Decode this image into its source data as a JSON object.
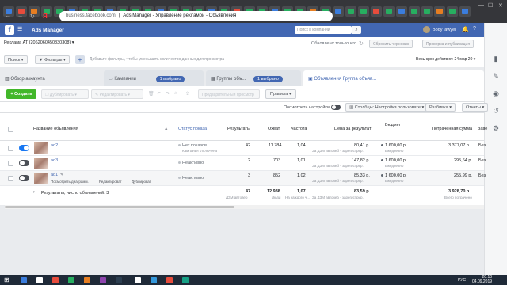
{
  "browser": {
    "tab_title": "Ads Manager - Управление рекламой - Объявления",
    "url_host": "business.facebook.com",
    "url_sep": "|"
  },
  "fbheader": {
    "logo": "f",
    "title": "Ads Manager",
    "search_placeholder": "Поиск в компании",
    "user_name": "Body lawyer"
  },
  "account": {
    "selector": "Реклама AT (2062060450830308)",
    "updated": "Обновлено только что",
    "discard_label": "Сбросить черновик",
    "review_label": "Проверка и публикация"
  },
  "filters": {
    "search_label": "Поиск",
    "filters_label": "Фильтры",
    "hint": "Добавьте фильтры, чтобы уменьшить количество данных для просмотра",
    "period": "Весь срок действия: 24 мар 20"
  },
  "levels": {
    "account_tab": "Обзор аккаунта",
    "campaigns_tab": "Кампании",
    "campaigns_pill": "1 выбрано",
    "adsets_tab": "Группы объ...",
    "adsets_pill": "1 выбрано",
    "ads_tab": "Объявления Группа объяв..."
  },
  "toolbar": {
    "create": "+ Создать",
    "duplicate": "Дублировать",
    "edit": "Редактировать",
    "preview": "Предварительный просмотр",
    "rules": "Правила"
  },
  "table": {
    "view_settings_label": "Посмотреть настройки",
    "columns_label": "Столбцы: Настройки пользовате",
    "breakdown_label": "Разбивка",
    "reports_label": "Отчеты",
    "headers": {
      "name": "Название объявления",
      "warning": "▲",
      "status": "Статус показа",
      "results": "Результаты",
      "reach": "Охват",
      "frequency": "Частота",
      "cost": "Цена за результат",
      "budget": "Бюджет",
      "spent": "Потраченная сумма",
      "ends": "Заве"
    },
    "rows": [
      {
        "name": "ad2",
        "status": "Нет показов",
        "status_sub": "Кампания отключена",
        "results": "42",
        "reach": "11 784",
        "frequency": "1,04",
        "cost": "80,41 р.",
        "cost_sub": "За ДЗМ автовеб - зарегистрир.",
        "budget": "1 600,00 р.",
        "budget_sub": "Ежедневно",
        "spent": "3 377,07 р.",
        "ends": "Без",
        "on": true
      },
      {
        "name": "ad3",
        "status": "Неактивно",
        "status_sub": "",
        "results": "2",
        "reach": "703",
        "frequency": "1,01",
        "cost": "147,82 р.",
        "cost_sub": "За ДЗМ автовеб - зарегистрир.",
        "budget": "1 600,00 р.",
        "budget_sub": "Ежедневно",
        "spent": "295,64 р.",
        "ends": "Без",
        "on": false
      },
      {
        "name": "ad1",
        "status": "Неактивно",
        "status_sub": "",
        "results": "3",
        "reach": "852",
        "frequency": "1,02",
        "cost": "85,33 р.",
        "cost_sub": "За ДЗМ автовеб - зарегистрир.",
        "budget": "1 600,00 р.",
        "budget_sub": "Ежедневно",
        "spent": "255,99 р.",
        "ends": "Без",
        "on": false
      }
    ],
    "row_actions": {
      "view": "Посмотреть диаграмм.",
      "edit": "Редактироват",
      "duplicate": "Дублироват"
    },
    "totals": {
      "label": "Результаты, число объявлений: 3",
      "results": "47",
      "results_sub": "ДЗМ автовеб",
      "reach": "12 938",
      "reach_sub": "Люди",
      "frequency": "1,07",
      "frequency_sub": "На каждого ч...",
      "cost": "83,59 р.",
      "cost_sub": "За ДЗМ автовеб - зарегистрир.",
      "spent": "3 928,70 р.",
      "spent_sub": "Всего потрачено"
    }
  },
  "taskbar": {
    "lang": "РУС",
    "time": "20:10",
    "date": "04.09.2019"
  },
  "colors": {
    "fb_blue": "#4267b2",
    "create_green": "#42b72a",
    "toggle_on": "#1877f2",
    "toggle_off": "#4b4f56"
  }
}
